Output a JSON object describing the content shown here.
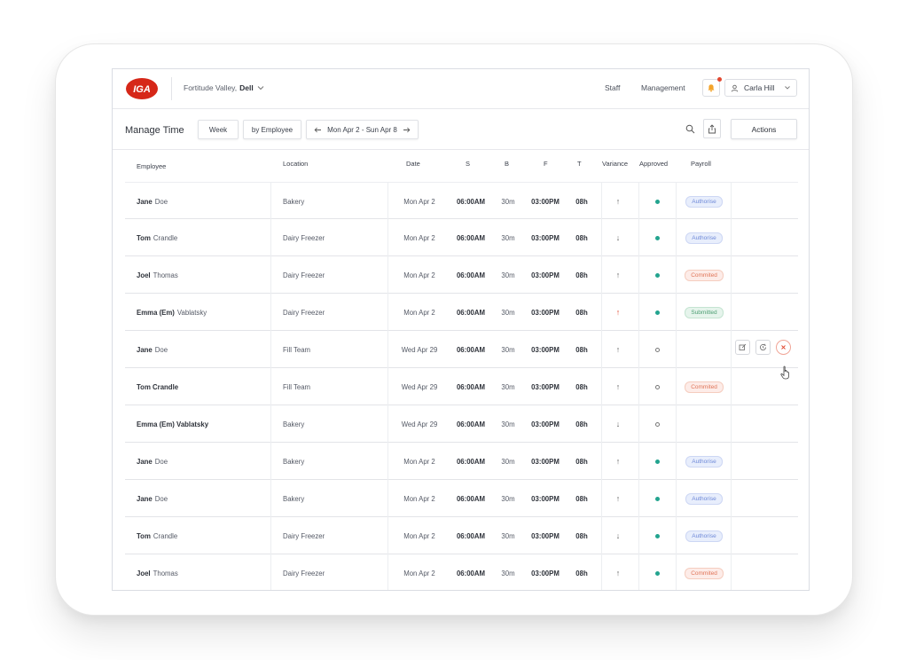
{
  "header": {
    "store": {
      "area": "Fortitude Valley,",
      "name": "Dell"
    },
    "nav": {
      "staff": "Staff",
      "management": "Management"
    },
    "user_name": "Carla Hill",
    "brand_color": "#d62718"
  },
  "toolbar": {
    "title": "Manage Time",
    "week_label": "Week",
    "group_label": "by Employee",
    "date_range": "Mon Apr 2 - Sun Apr 8",
    "actions_label": "Actions"
  },
  "columns": {
    "employee": "Employee",
    "location": "Location",
    "date": "Date",
    "s": "S",
    "b": "B",
    "f": "F",
    "t": "T",
    "variance": "Variance",
    "approved": "Approved",
    "payroll": "Payroll"
  },
  "rows": [
    {
      "first": "Jane",
      "last": "Doe",
      "location": "Bakery",
      "date": "Mon Apr 2",
      "s": "06:00AM",
      "b": "30m",
      "f": "03:00PM",
      "t": "08h",
      "variance": "↑",
      "approved": true,
      "payroll": "Authorise"
    },
    {
      "first": "Tom",
      "last": "Crandle",
      "location": "Dairy Freezer",
      "date": "Mon Apr 2",
      "s": "06:00AM",
      "b": "30m",
      "f": "03:00PM",
      "t": "08h",
      "variance": "↓",
      "approved": true,
      "payroll": "Authorise"
    },
    {
      "first": "Joel",
      "last": "Thomas",
      "location": "Dairy Freezer",
      "date": "Mon Apr 2",
      "s": "06:00AM",
      "b": "30m",
      "f": "03:00PM",
      "t": "08h",
      "variance": "↑",
      "approved": true,
      "payroll": "Commited"
    },
    {
      "first": "Emma (Em)",
      "last": "Vablatsky",
      "location": "Dairy Freezer",
      "date": "Mon Apr 2",
      "s": "06:00AM",
      "b": "30m",
      "f": "03:00PM",
      "t": "08h",
      "variance": "↑",
      "approved": true,
      "payroll": "Submitted"
    },
    {
      "first": "Jane",
      "last": "Doe",
      "location": "Fill Team",
      "date": "Wed Apr 29",
      "s": "06:00AM",
      "b": "30m",
      "f": "03:00PM",
      "t": "08h",
      "variance": "↑",
      "approved": false,
      "payroll": ""
    },
    {
      "first": "Tom Crandle",
      "last": "",
      "location": "Fill Team",
      "date": "Wed Apr 29",
      "s": "06:00AM",
      "b": "30m",
      "f": "03:00PM",
      "t": "08h",
      "variance": "↑",
      "approved": false,
      "payroll": "Commited"
    },
    {
      "first": "Emma (Em) Vablatsky",
      "last": "",
      "location": "Bakery",
      "date": "Wed Apr 29",
      "s": "06:00AM",
      "b": "30m",
      "f": "03:00PM",
      "t": "08h",
      "variance": "↓",
      "approved": false,
      "payroll": ""
    },
    {
      "first": "Jane",
      "last": "Doe",
      "location": "Bakery",
      "date": "Mon Apr 2",
      "s": "06:00AM",
      "b": "30m",
      "f": "03:00PM",
      "t": "08h",
      "variance": "↑",
      "approved": true,
      "payroll": "Authorise"
    },
    {
      "first": "Jane",
      "last": "Doe",
      "location": "Bakery",
      "date": "Mon Apr 2",
      "s": "06:00AM",
      "b": "30m",
      "f": "03:00PM",
      "t": "08h",
      "variance": "↑",
      "approved": true,
      "payroll": "Authorise"
    },
    {
      "first": "Tom",
      "last": "Crandle",
      "location": "Dairy Freezer",
      "date": "Mon Apr 2",
      "s": "06:00AM",
      "b": "30m",
      "f": "03:00PM",
      "t": "08h",
      "variance": "↓",
      "approved": true,
      "payroll": "Authorise"
    },
    {
      "first": "Joel",
      "last": "Thomas",
      "location": "Dairy Freezer",
      "date": "Mon Apr 2",
      "s": "06:00AM",
      "b": "30m",
      "f": "03:00PM",
      "t": "08h",
      "variance": "↑",
      "approved": true,
      "payroll": "Commited"
    }
  ],
  "highlighted": {
    "variance_red_row": 3,
    "hover_row": 4
  },
  "row_action_icons": [
    "edit-icon",
    "history-icon",
    "close-icon"
  ],
  "colors": {
    "approved": "#23a48f",
    "variance_alert": "#e24a33"
  }
}
